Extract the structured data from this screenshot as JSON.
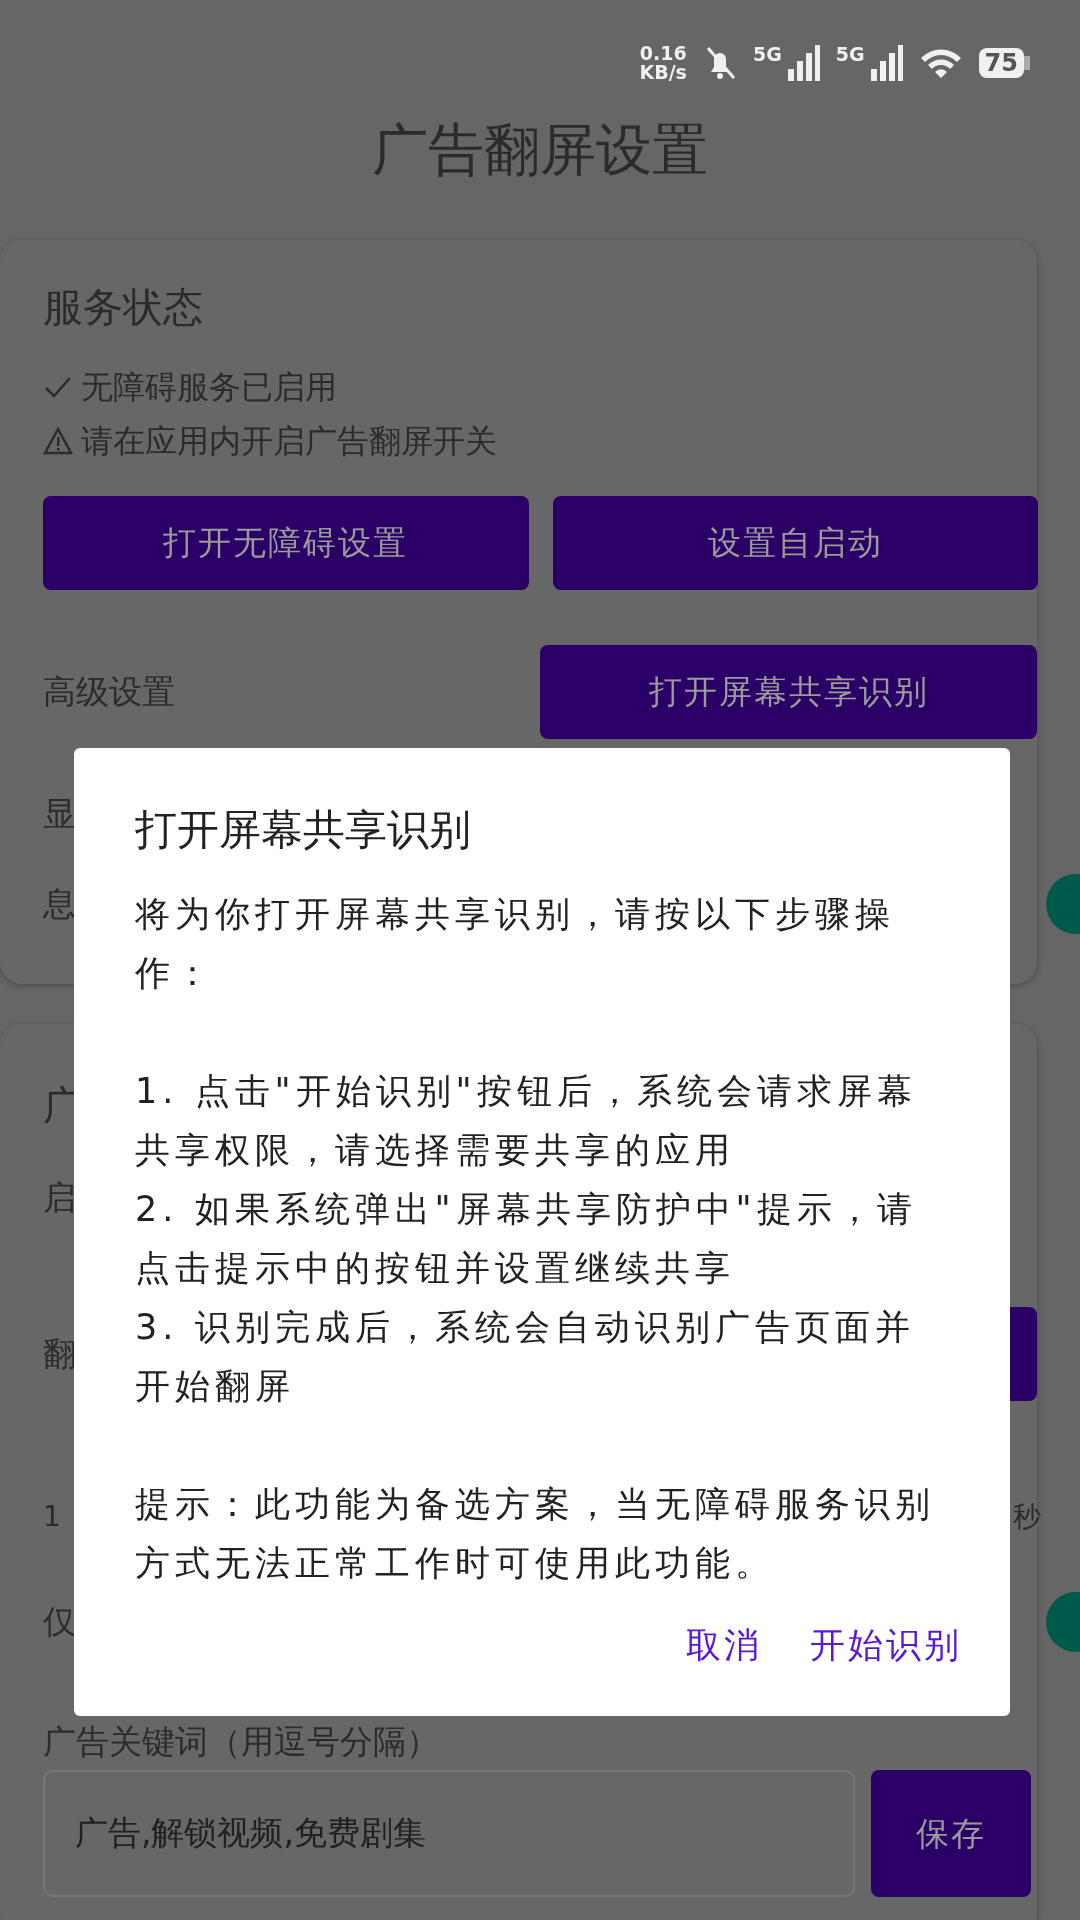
{
  "status_bar": {
    "speed_value": "0.16",
    "speed_unit": "KB/s",
    "networks": [
      "5G",
      "5G"
    ],
    "battery": "75"
  },
  "title": "广告翻屏设置",
  "service_card": {
    "title": "服务状态",
    "status_lines": [
      {
        "kind": "ok",
        "text": "无障碍服务已启用"
      },
      {
        "kind": "warning",
        "text": "请在应用内开启广告翻屏开关"
      }
    ],
    "buttons": [
      "打开无障碍设置",
      "设置自启动"
    ],
    "advanced_label": "高级设置",
    "advanced_button": "打开屏幕共享识别",
    "rows": [
      {
        "label": "显"
      },
      {
        "label": "息",
        "on": true
      }
    ]
  },
  "ad_card": {
    "title": "广",
    "rows": [
      {
        "kind": "text",
        "label": "启"
      },
      {
        "kind": "button",
        "label": "翻"
      },
      {
        "kind": "range",
        "label": "1",
        "end_label": "秒"
      },
      {
        "kind": "switch",
        "label": "仅",
        "on": true
      }
    ],
    "keywords_label": "广告关键词（用逗号分隔）",
    "keywords_value": "广告,解锁视频,免费剧集",
    "save_button": "保存"
  },
  "dialog": {
    "title": "打开屏幕共享识别",
    "sections": [
      [
        "将为你打开屏幕共享识别，请按以下步骤操作："
      ],
      [
        "1. 点击\"开始识别\"按钮后，系统会请求屏幕共享权限，请选择需要共享的应用",
        "2. 如果系统弹出\"屏幕共享防护中\"提示，请点击提示中的按钮并设置继续共享",
        "3. 识别完成后，系统会自动识别广告页面并开始翻屏"
      ],
      [
        "提示：此功能为备选方案，当无障碍服务识别方式无法正常工作时可使用此功能。"
      ]
    ],
    "buttons": [
      "取消",
      "开始识别"
    ]
  }
}
